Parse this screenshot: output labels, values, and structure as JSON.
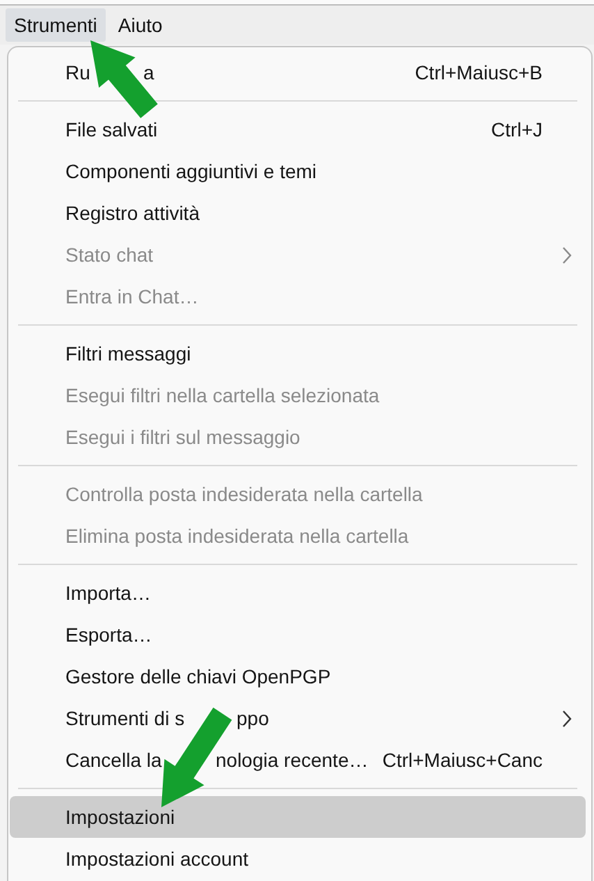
{
  "menubar": [
    {
      "label": "Strumenti",
      "selected": true
    },
    {
      "label": "Aiuto",
      "selected": false
    }
  ],
  "menu": [
    {
      "kind": "item",
      "label_parts": [
        "Ru",
        "a"
      ],
      "shortcut": "Ctrl+Maiusc+B",
      "disabled": false,
      "selected": false
    },
    {
      "kind": "separator"
    },
    {
      "kind": "item",
      "label": "File salvati",
      "shortcut": "Ctrl+J",
      "disabled": false,
      "selected": false
    },
    {
      "kind": "item",
      "label": "Componenti aggiuntivi e temi",
      "disabled": false,
      "selected": false
    },
    {
      "kind": "item",
      "label": "Registro attività",
      "disabled": false,
      "selected": false
    },
    {
      "kind": "item",
      "label": "Stato chat",
      "disabled": true,
      "submenu": true,
      "selected": false
    },
    {
      "kind": "item",
      "label": "Entra in Chat…",
      "disabled": true,
      "selected": false
    },
    {
      "kind": "separator"
    },
    {
      "kind": "item",
      "label": "Filtri messaggi",
      "disabled": false,
      "selected": false
    },
    {
      "kind": "item",
      "label": "Esegui filtri nella cartella selezionata",
      "disabled": true,
      "selected": false
    },
    {
      "kind": "item",
      "label": "Esegui i filtri sul messaggio",
      "disabled": true,
      "selected": false
    },
    {
      "kind": "separator"
    },
    {
      "kind": "item",
      "label": "Controlla posta indesiderata nella cartella",
      "disabled": true,
      "selected": false
    },
    {
      "kind": "item",
      "label": "Elimina posta indesiderata nella cartella",
      "disabled": true,
      "selected": false
    },
    {
      "kind": "separator"
    },
    {
      "kind": "item",
      "label": "Importa…",
      "disabled": false,
      "selected": false
    },
    {
      "kind": "item",
      "label": "Esporta…",
      "disabled": false,
      "selected": false
    },
    {
      "kind": "item",
      "label": "Gestore delle chiavi OpenPGP",
      "disabled": false,
      "selected": false
    },
    {
      "kind": "item",
      "label_parts": [
        "Strumenti di s",
        "ppo"
      ],
      "disabled": false,
      "submenu": true,
      "selected": false
    },
    {
      "kind": "item",
      "label_parts": [
        "Cancella la",
        "nologia recente…"
      ],
      "shortcut": "Ctrl+Maiusc+Canc",
      "disabled": false,
      "selected": false
    },
    {
      "kind": "separator"
    },
    {
      "kind": "item",
      "label": "Impostazioni",
      "disabled": false,
      "selected": true
    },
    {
      "kind": "item",
      "label": "Impostazioni account",
      "disabled": false,
      "selected": false
    }
  ]
}
